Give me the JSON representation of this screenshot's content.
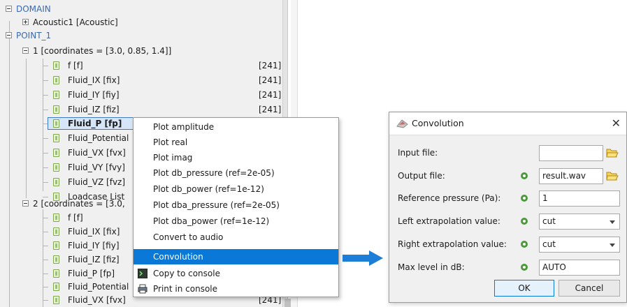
{
  "tree": {
    "domain_label": "DOMAIN",
    "acoustic_label": "Acoustic1 [Acoustic]",
    "point1_label": "POINT_1",
    "group1_label": "1 [coordinates = [3.0, 0.85, 1.4]]",
    "group1_items": [
      {
        "label": "f  [f]",
        "value": "[241]"
      },
      {
        "label": "Fluid_IX  [fix]",
        "value": "[241]"
      },
      {
        "label": "Fluid_IY  [fiy]",
        "value": "[241]"
      },
      {
        "label": "Fluid_IZ  [fiz]",
        "value": "[241]"
      },
      {
        "label": "Fluid_P  [fp]",
        "value": "[2..."
      },
      {
        "label": "Fluid_Potential",
        "value": ""
      },
      {
        "label": "Fluid_VX  [fvx]",
        "value": ""
      },
      {
        "label": "Fluid_VY  [fvy]",
        "value": ""
      },
      {
        "label": "Fluid_VZ  [fvz]",
        "value": ""
      },
      {
        "label": "Loadcase List",
        "value": ""
      }
    ],
    "group2_label": "2 [coordinates = [3.0,",
    "group2_items": [
      {
        "label": "f  [f]",
        "value": ""
      },
      {
        "label": "Fluid_IX  [fix]",
        "value": ""
      },
      {
        "label": "Fluid_IY  [fiy]",
        "value": ""
      },
      {
        "label": "Fluid_IZ  [fiz]",
        "value": ""
      },
      {
        "label": "Fluid_P  [fp]",
        "value": ""
      },
      {
        "label": "Fluid_Potential",
        "value": ""
      },
      {
        "label": "Fluid_VX  [fvx]",
        "value": "[241]"
      }
    ]
  },
  "context_menu": {
    "items": [
      "Plot amplitude",
      "Plot real",
      "Plot imag",
      "Plot db_pressure (ref=2e-05)",
      "Plot db_power (ref=1e-12)",
      "Plot dba_pressure (ref=2e-05)",
      "Plot dba_power (ref=1e-12)",
      "Convert to audio",
      "Convolution",
      "Copy to console",
      "Print in console"
    ],
    "active_index": 8,
    "highlight_color": "#0a78d7"
  },
  "dialog": {
    "title": "Convolution",
    "close_glyph": "✕",
    "fields": {
      "input_file": {
        "label": "Input file:",
        "value": ""
      },
      "output_file": {
        "label": "Output file:",
        "value": "result.wav"
      },
      "ref_pressure": {
        "label": "Reference pressure (Pa):",
        "value": "1"
      },
      "left_extrap": {
        "label": "Left extrapolation value:",
        "value": "cut"
      },
      "right_extrap": {
        "label": "Right extrapolation value:",
        "value": "cut"
      },
      "max_level": {
        "label": "Max level in dB:",
        "value": "AUTO"
      }
    },
    "ok_label": "OK",
    "cancel_label": "Cancel"
  },
  "colors": {
    "tree_blue": "#3a69b0",
    "arrow": "#1c7ed6",
    "selection": "#d6e5f7"
  }
}
